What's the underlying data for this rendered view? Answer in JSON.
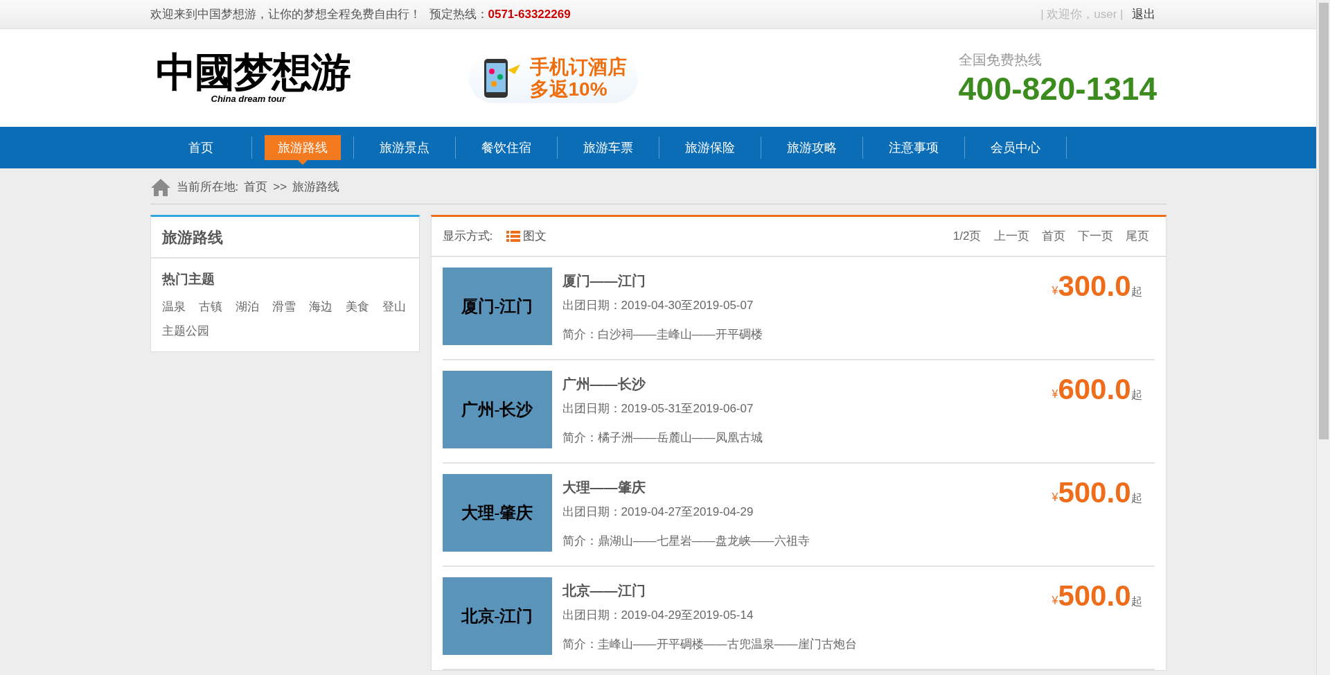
{
  "top_bar": {
    "welcome": "欢迎来到中国梦想游，让你的梦想全程免费自由行！",
    "hotline_label": "预定热线：",
    "hotline": "0571-63322269",
    "user_greeting": "| 欢迎你，user |",
    "logout": "退出"
  },
  "header": {
    "logo_text": "中國梦想游",
    "logo_subtitle": "China dream tour",
    "banner_line_1": "手机订酒店",
    "banner_line_2": "多返10%",
    "hotline_label": "全国免费热线",
    "hotline": "400-820-1314"
  },
  "nav": [
    {
      "label": "首页",
      "selected": false
    },
    {
      "label": "旅游路线",
      "selected": true
    },
    {
      "label": "旅游景点",
      "selected": false
    },
    {
      "label": "餐饮住宿",
      "selected": false
    },
    {
      "label": "旅游车票",
      "selected": false
    },
    {
      "label": "旅游保险",
      "selected": false
    },
    {
      "label": "旅游攻略",
      "selected": false
    },
    {
      "label": "注意事项",
      "selected": false
    },
    {
      "label": "会员中心",
      "selected": false
    }
  ],
  "breadcrumb": {
    "label": "当前所在地:",
    "items": [
      "首页",
      ">>",
      "旅游路线"
    ]
  },
  "sidebar": {
    "title": "旅游路线",
    "section_title": "热门主题",
    "tags": [
      "温泉",
      "古镇",
      "湖泊",
      "滑雪",
      "海边",
      "美食",
      "登山",
      "主题公园"
    ]
  },
  "list_header": {
    "display_label": "显示方式:",
    "view_mode": "图文",
    "pagination": [
      "1/2页",
      "上一页",
      "首页",
      "下一页",
      "尾页"
    ]
  },
  "routes": [
    {
      "thumb_text": "厦门-江门",
      "title": "厦门——江门",
      "dates": "出团日期：2019-04-30至2019-05-07",
      "intro": "简介：白沙祠——圭峰山——开平碉楼",
      "currency": "¥",
      "price": "300.0",
      "suffix": "起"
    },
    {
      "thumb_text": "广州-长沙",
      "title": "广州——长沙",
      "dates": "出团日期：2019-05-31至2019-06-07",
      "intro": "简介：橘子洲——岳麓山——凤凰古城",
      "currency": "¥",
      "price": "600.0",
      "suffix": "起"
    },
    {
      "thumb_text": "大理-肇庆",
      "title": "大理——肇庆",
      "dates": "出团日期：2019-04-27至2019-04-29",
      "intro": "简介：鼎湖山——七星岩——盘龙峡——六祖寺",
      "currency": "¥",
      "price": "500.0",
      "suffix": "起"
    },
    {
      "thumb_text": "北京-江门",
      "title": "北京——江门",
      "dates": "出团日期：2019-04-29至2019-05-14",
      "intro": "简介：圭峰山——开平碉楼——古兜温泉——崖门古炮台",
      "currency": "¥",
      "price": "500.0",
      "suffix": "起"
    }
  ]
}
